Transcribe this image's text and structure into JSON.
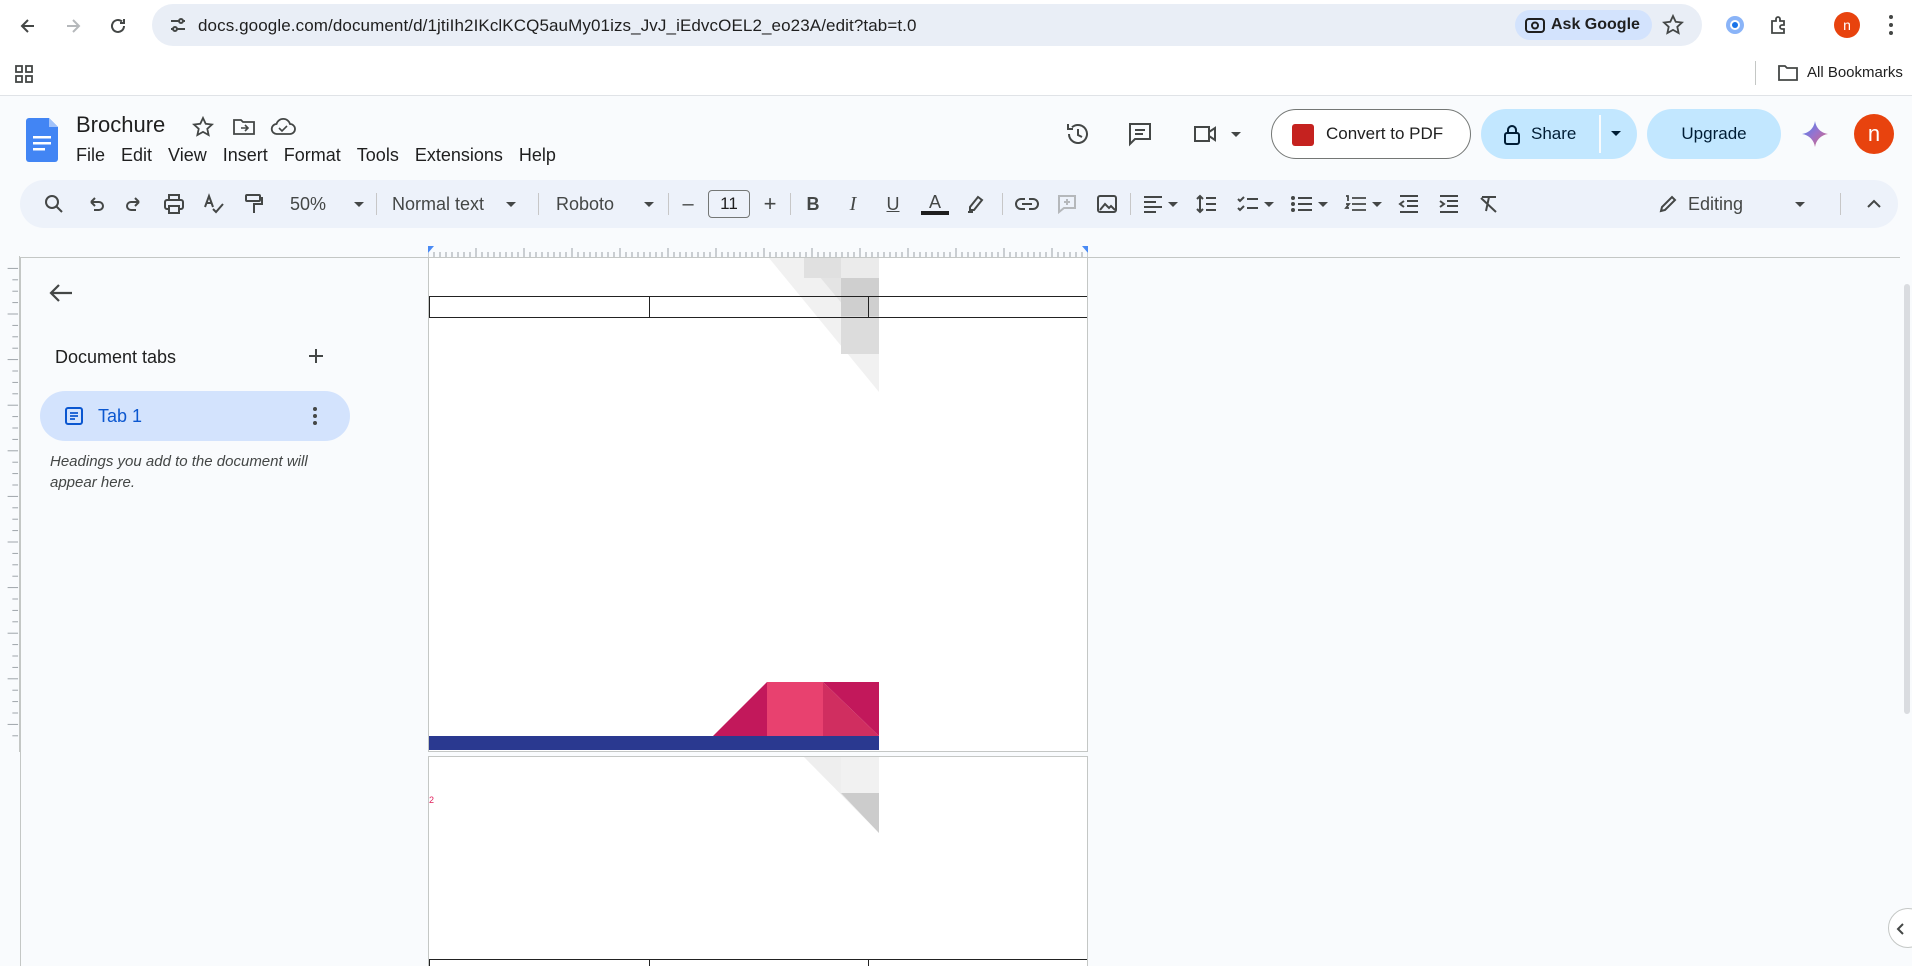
{
  "browser": {
    "url": "docs.google.com/document/d/1jtiIh2IKclKCQ5auMy01izs_JvJ_iEdvcOEL2_eo23A/edit?tab=t.0",
    "ask_google_label": "Ask Google",
    "profile_initial": "n",
    "all_bookmarks_label": "All Bookmarks"
  },
  "doc": {
    "title": "Brochure",
    "menu": [
      "File",
      "Edit",
      "View",
      "Insert",
      "Format",
      "Tools",
      "Extensions",
      "Help"
    ],
    "convert_label": "Convert to PDF",
    "share_label": "Share",
    "upgrade_label": "Upgrade",
    "avatar_initial": "n"
  },
  "toolbar": {
    "zoom": "50%",
    "style": "Normal text",
    "font": "Roboto",
    "font_size": "11",
    "minus": "–",
    "plus": "+",
    "bold": "B",
    "italic": "I",
    "underline": "U",
    "text_color": "A",
    "mode": "Editing"
  },
  "sidebar": {
    "section_title": "Document tabs",
    "tabs": [
      {
        "label": "Tab 1"
      }
    ],
    "hint": "Headings you add to the document will appear here."
  },
  "pages": {
    "page2_number": "2"
  },
  "colors": {
    "accent_blue": "#0b57d0",
    "share_bg": "#c2e7ff",
    "tab_selected_bg": "#d3e3fd",
    "toolbar_bg": "#edf2fa",
    "avatar_bg": "#e8430e",
    "brochure_navy": "#2a3990",
    "brochure_pink": "#e8416f",
    "brochure_crimson": "#c2185b"
  }
}
